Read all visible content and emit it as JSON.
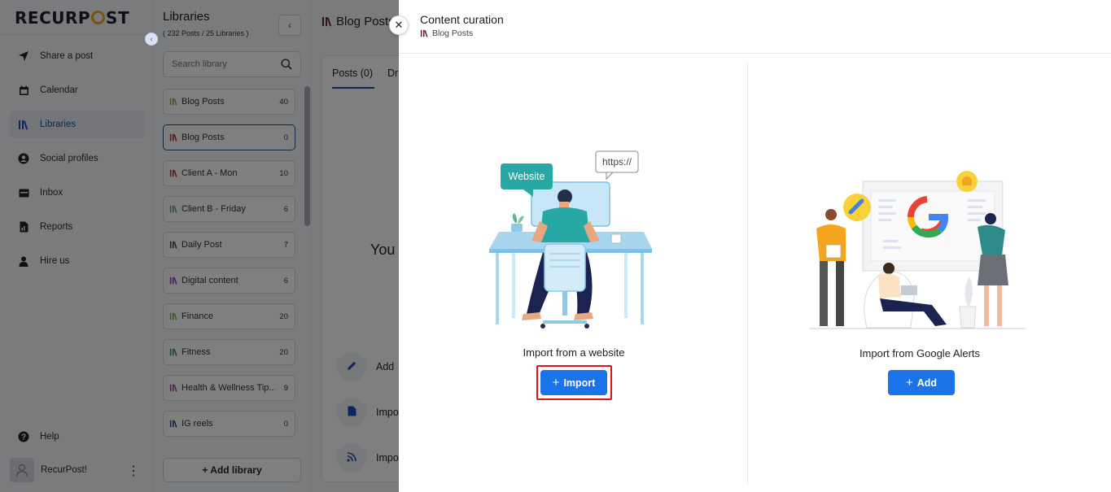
{
  "brand": {
    "logo_text_a": "RECURP",
    "logo_text_b": "ST",
    "accent": "#f4a51d"
  },
  "nav": {
    "items": [
      {
        "label": "Share a post",
        "icon": "send-icon"
      },
      {
        "label": "Calendar",
        "icon": "calendar-icon"
      },
      {
        "label": "Libraries",
        "icon": "library-icon",
        "active": true
      },
      {
        "label": "Social profiles",
        "icon": "user-circle-icon"
      },
      {
        "label": "Inbox",
        "icon": "inbox-icon"
      },
      {
        "label": "Reports",
        "icon": "report-icon"
      },
      {
        "label": "Hire us",
        "icon": "person-icon"
      }
    ],
    "help": "Help",
    "user": "RecurPost!"
  },
  "libraries": {
    "title": "Libraries",
    "subtitle": "( 232 Posts / 25 Libraries )",
    "search_placeholder": "Search library",
    "items": [
      {
        "name": "Blog Posts",
        "count": "40",
        "color": "#7bb04b"
      },
      {
        "name": "Blog Posts",
        "count": "0",
        "color": "#a6323a",
        "selected": true
      },
      {
        "name": "Client A - Mon",
        "count": "10",
        "color": "#a6323a"
      },
      {
        "name": "Client B - Friday",
        "count": "6",
        "color": "#5a9e8a"
      },
      {
        "name": "Daily Post",
        "count": "7",
        "color": "#444444"
      },
      {
        "name": "Digital content",
        "count": "6",
        "color": "#8a3fb8"
      },
      {
        "name": "Finance",
        "count": "20",
        "color": "#7bb04b"
      },
      {
        "name": "Fitness",
        "count": "20",
        "color": "#2e8a6e"
      },
      {
        "name": "Health & Wellness Tip...",
        "count": "9",
        "color": "#b03aa0"
      },
      {
        "name": "IG reels",
        "count": "0",
        "color": "#2b4a8c"
      }
    ],
    "add_label": "+ Add library"
  },
  "main": {
    "header": "Blog Posts",
    "tab_posts": "Posts (0)",
    "tab_drafts": "Dr",
    "empty_text": "You",
    "actions": [
      "Add",
      "Impo",
      "Impo"
    ]
  },
  "modal": {
    "title": "Content curation",
    "subtitle": "Blog Posts",
    "option_website": {
      "label": "Import from a website",
      "button": "Import",
      "bubble": "Website",
      "url_bubble": "https://"
    },
    "option_alerts": {
      "label": "Import from Google Alerts",
      "button": "Add"
    },
    "button_color": "#1a73e8",
    "highlight_color": "#e0141b"
  }
}
